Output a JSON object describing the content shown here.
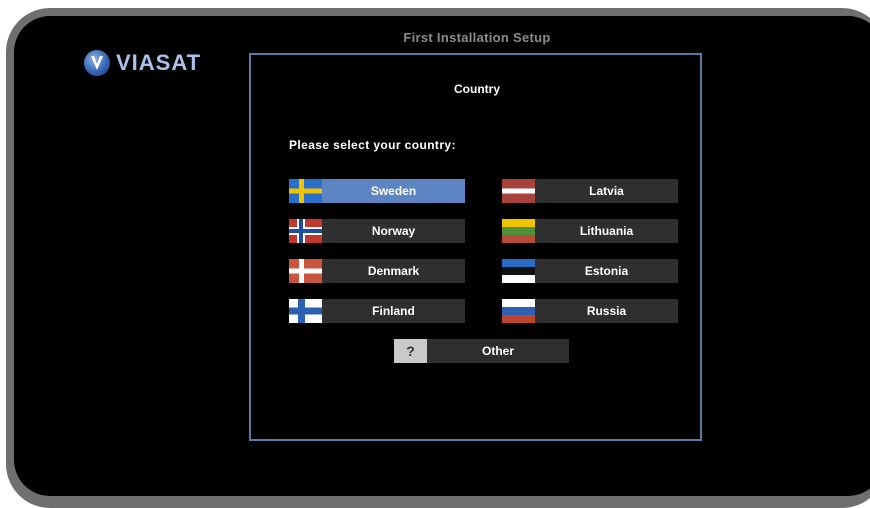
{
  "brand": {
    "name": "VIASAT"
  },
  "header": {
    "title": "First Installation Setup"
  },
  "dialog": {
    "title": "Country",
    "prompt": "Please select your country:"
  },
  "countries": [
    {
      "label": "Sweden",
      "flag": "sweden-flag-icon",
      "selected": true
    },
    {
      "label": "Norway",
      "flag": "norway-flag-icon",
      "selected": false
    },
    {
      "label": "Denmark",
      "flag": "denmark-flag-icon",
      "selected": false
    },
    {
      "label": "Finland",
      "flag": "finland-flag-icon",
      "selected": false
    },
    {
      "label": "Latvia",
      "flag": "latvia-flag-icon",
      "selected": false
    },
    {
      "label": "Lithuania",
      "flag": "lithuania-flag-icon",
      "selected": false
    },
    {
      "label": "Estonia",
      "flag": "estonia-flag-icon",
      "selected": false
    },
    {
      "label": "Russia",
      "flag": "russia-flag-icon",
      "selected": false
    }
  ],
  "other": {
    "label": "Other",
    "icon_glyph": "?"
  },
  "colors": {
    "selected": "#5d84c3",
    "button": "#2f2f2f",
    "panel_border": "#5b7aa3",
    "bezel": "#6f6f6f"
  }
}
